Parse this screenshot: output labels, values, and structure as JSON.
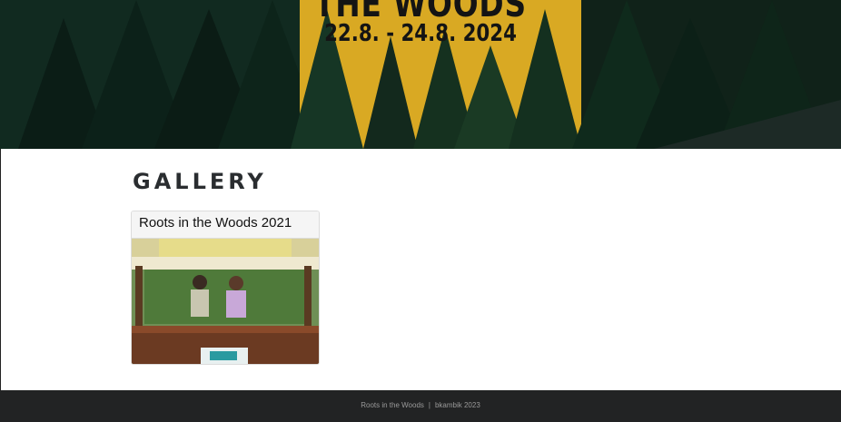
{
  "hero": {
    "title": "THE WOODS",
    "dates": "22.8. - 24.8. 2024"
  },
  "gallery": {
    "heading": "GALLERY",
    "albums": [
      {
        "title": "Roots in the Woods 2021"
      }
    ]
  },
  "footer": {
    "site_name": "Roots in the Woods",
    "separator": "|",
    "credit": "bkambik 2023"
  },
  "colors": {
    "hero_yellow": "#e0b124",
    "forest_dark": "#0e1c18",
    "footer_bg": "#222324",
    "heading_text": "#2a2d30"
  }
}
